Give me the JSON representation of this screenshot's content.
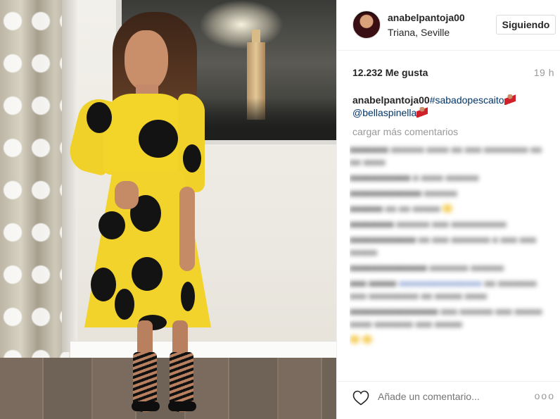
{
  "post": {
    "username": "anabelpantoja00",
    "location": "Triana, Seville",
    "follow_button": "Siguiendo",
    "likes": "12.232 Me gusta",
    "time_ago": "19 h",
    "caption": {
      "user": "anabelpantoja00",
      "hashtag": "#sabadopescaito",
      "mention": "@bellaspinella"
    },
    "load_more": "cargar más comentarios",
    "comment_placeholder": "Añade un comentario...",
    "more_options": "ooo"
  },
  "colors": {
    "text": "#262626",
    "muted": "#999999",
    "link": "#003569",
    "border": "#dbdbdb"
  },
  "icons": [
    "heart-icon",
    "more-options-icon",
    "flamenco-dancer-emoji"
  ]
}
